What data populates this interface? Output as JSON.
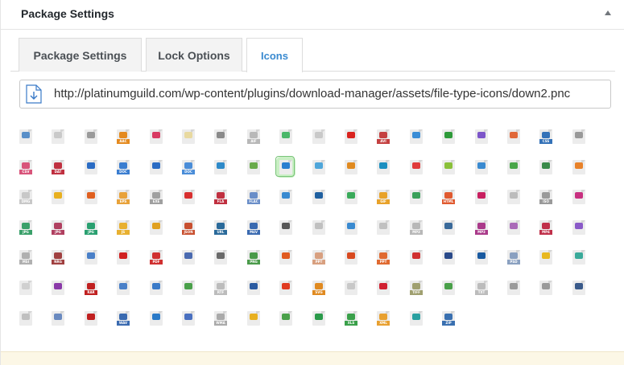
{
  "header": {
    "title": "Package Settings"
  },
  "tabs": [
    {
      "label": "Package Settings"
    },
    {
      "label": "Lock Options"
    },
    {
      "label": "Icons",
      "active": true
    }
  ],
  "url_field": {
    "value": "http://platinumguild.com/wp-content/plugins/download-manager/assets/file-type-icons/down2.pnc",
    "icon": "download-file-icon"
  },
  "icons": [
    [
      "down",
      "#5a8fc8",
      ""
    ],
    [
      "blank",
      "#c9c9c9",
      ""
    ],
    [
      "disc",
      "#9a9a9a",
      ""
    ],
    [
      "aac",
      "#e48a1f",
      "AAC"
    ],
    [
      "acrobat",
      "#d83a62",
      ""
    ],
    [
      "blank",
      "#e8d9a0",
      ""
    ],
    [
      "mouse",
      "#8a8a8a",
      ""
    ],
    [
      "aif",
      "#b8b8b8",
      "AIF"
    ],
    [
      "down-green",
      "#4bb76a",
      ""
    ],
    [
      "audio",
      "#c9c9c9",
      ""
    ],
    [
      "avi",
      "#d9231e",
      ""
    ],
    [
      "avi",
      "#c44040",
      "AVI"
    ],
    [
      "image",
      "#3b8dd6",
      ""
    ],
    [
      "down-box",
      "#2e9a3a",
      ""
    ],
    [
      "cloud",
      "#7c55c9",
      ""
    ],
    [
      "code",
      "#e0683a",
      ""
    ],
    [
      "css",
      "#3472b8",
      "CSS"
    ],
    [
      "disc",
      "#999999",
      ""
    ],
    [
      "csv",
      "#d8547a",
      "CSV"
    ],
    [
      "dat",
      "#c03040",
      "DAT"
    ],
    [
      "doc",
      "#2b6cc4",
      ""
    ],
    [
      "doc",
      "#3a7dd0",
      "DOC"
    ],
    [
      "word",
      "#2b6cc4",
      ""
    ],
    [
      "doc",
      "#4a8dd8",
      "DOC"
    ],
    [
      "word",
      "#2e8ac9",
      ""
    ],
    [
      "db",
      "#6aaa4c",
      ""
    ],
    [
      "down2",
      "#2a7fd0",
      ""
    ],
    [
      "box",
      "#4fa6da",
      ""
    ],
    [
      "circle-down",
      "#e08a20",
      ""
    ],
    [
      "circle-down",
      "#1c8fc0",
      ""
    ],
    [
      "red-down",
      "#e03a3a",
      ""
    ],
    [
      "android",
      "#8ac03a",
      ""
    ],
    [
      "camera",
      "#3a8ad0",
      ""
    ],
    [
      "green-box",
      "#4aa64a",
      ""
    ],
    [
      "stamp",
      "#3a8a4a",
      ""
    ],
    [
      "orange",
      "#e8822a",
      ""
    ],
    [
      "dmg",
      "#c8c8c8",
      "DMG"
    ],
    [
      "circle",
      "#e8b020",
      ""
    ],
    [
      "doc-orange",
      "#e06020",
      ""
    ],
    [
      "eps",
      "#e8a23a",
      "EPS"
    ],
    [
      "exe",
      "#a0a0a0",
      "EXE"
    ],
    [
      "pdf",
      "#d83030",
      ""
    ],
    [
      "fla",
      "#c03040",
      "FLA"
    ],
    [
      "flac",
      "#6a8ec8",
      "FLAC"
    ],
    [
      "landscape",
      "#3a8ad0",
      ""
    ],
    [
      "blue-dot",
      "#2060a0",
      ""
    ],
    [
      "check",
      "#3aaa5a",
      ""
    ],
    [
      "gif",
      "#e8a22a",
      "GIF"
    ],
    [
      "green",
      "#3aa05a",
      ""
    ],
    [
      "html",
      "#e05a30",
      "HTML"
    ],
    [
      "indd",
      "#c82060",
      ""
    ],
    [
      "iso",
      "#bcbcbc",
      ""
    ],
    [
      "iso",
      "#9a9a9a",
      "ISO"
    ],
    [
      "video",
      "#c83080",
      ""
    ],
    [
      "jpg",
      "#3aa06a",
      "JPG"
    ],
    [
      "jpg",
      "#b04060",
      "JPG"
    ],
    [
      "jpg",
      "#2aa070",
      "JPG"
    ],
    [
      "js",
      "#e8b030",
      "JS"
    ],
    [
      "jpg",
      "#e0a020",
      ""
    ],
    [
      "json",
      "#c85030",
      "JSON"
    ],
    [
      "url",
      "#2a6a9a",
      "URL"
    ],
    [
      "m4v",
      "#3a6ab0",
      "M4V"
    ],
    [
      "music",
      "#555555",
      ""
    ],
    [
      "audio",
      "#c0c0c0",
      ""
    ],
    [
      "q",
      "#3a8ad0",
      ""
    ],
    [
      "disc",
      "#c0c0c0",
      ""
    ],
    [
      "mp3",
      "#b8b8b8",
      "MP3"
    ],
    [
      "headphone",
      "#3a6a9a",
      ""
    ],
    [
      "mp3",
      "#aa3a8a",
      "MP3"
    ],
    [
      "mpg",
      "#aa6ab8",
      ""
    ],
    [
      "mp4",
      "#c0304a",
      "MP4"
    ],
    [
      "mpg",
      "#8a5ac8",
      ""
    ],
    [
      "msi",
      "#b0b0b0",
      "MSI"
    ],
    [
      "nrg",
      "#a04040",
      "NRG"
    ],
    [
      "pdf-line",
      "#4a80c8",
      ""
    ],
    [
      "pdf",
      "#d02020",
      ""
    ],
    [
      "pdf",
      "#d03030",
      "PDF"
    ],
    [
      "php",
      "#4a6ab0",
      ""
    ],
    [
      "gear",
      "#6a6a6a",
      ""
    ],
    [
      "png",
      "#4a9a4a",
      "PNG"
    ],
    [
      "ppt",
      "#e05a20",
      ""
    ],
    [
      "ppt",
      "#d8a080",
      "PPT"
    ],
    [
      "ppt",
      "#d84a20",
      ""
    ],
    [
      "ppt",
      "#e06a30",
      "PPT"
    ],
    [
      "question",
      "#d03030",
      ""
    ],
    [
      "psd",
      "#2a4a8a",
      ""
    ],
    [
      "psd",
      "#1a5aa0",
      ""
    ],
    [
      "psd",
      "#8aa0c0",
      "PSD"
    ],
    [
      "circle",
      "#e8b820",
      ""
    ],
    [
      "py",
      "#3aaa9a",
      ""
    ],
    [
      "txt",
      "#d0d0d0",
      ""
    ],
    [
      "rar",
      "#8a3aa8",
      ""
    ],
    [
      "rar",
      "#c02020",
      "RAR"
    ],
    [
      "list",
      "#4a80c8",
      ""
    ],
    [
      "person",
      "#3a7ac8",
      ""
    ],
    [
      "sheet",
      "#4aa04a",
      ""
    ],
    [
      "rtf",
      "#bcbcbc",
      "RTF"
    ],
    [
      "gear2",
      "#2a5aa0",
      ""
    ],
    [
      "swift",
      "#e03a20",
      ""
    ],
    [
      "svg",
      "#e08a20",
      "SVG"
    ],
    [
      "txt",
      "#c8c8c8",
      ""
    ],
    [
      "apple",
      "#d02030",
      ""
    ],
    [
      "tiff",
      "#a0a070",
      "TIFF"
    ],
    [
      "sheet2",
      "#4aa04a",
      ""
    ],
    [
      "txt",
      "#bcbcbc",
      "TXT"
    ],
    [
      "circle",
      "#9a9a9a",
      ""
    ],
    [
      "dots",
      "#9a9a9a",
      ""
    ],
    [
      "gear3",
      "#3a5a8a",
      ""
    ],
    [
      "disc",
      "#c0c0c0",
      ""
    ],
    [
      "wav",
      "#6a8ac0",
      ""
    ],
    [
      "wav",
      "#c02020",
      ""
    ],
    [
      "wav",
      "#3a6ab0",
      "WAV"
    ],
    [
      "globe",
      "#2a7ac8",
      ""
    ],
    [
      "volume",
      "#4a70c0",
      ""
    ],
    [
      "wma",
      "#aaaaaa",
      "WMA"
    ],
    [
      "xls",
      "#e8b020",
      ""
    ],
    [
      "xls",
      "#4aa04a",
      ""
    ],
    [
      "x",
      "#2a9a4a",
      ""
    ],
    [
      "xls",
      "#3aa04a",
      "XLS"
    ],
    [
      "xml",
      "#e8a030",
      "XML"
    ],
    [
      "zip",
      "#2aa0a0",
      ""
    ],
    [
      "zip",
      "#3a70b0",
      "ZIP"
    ]
  ]
}
